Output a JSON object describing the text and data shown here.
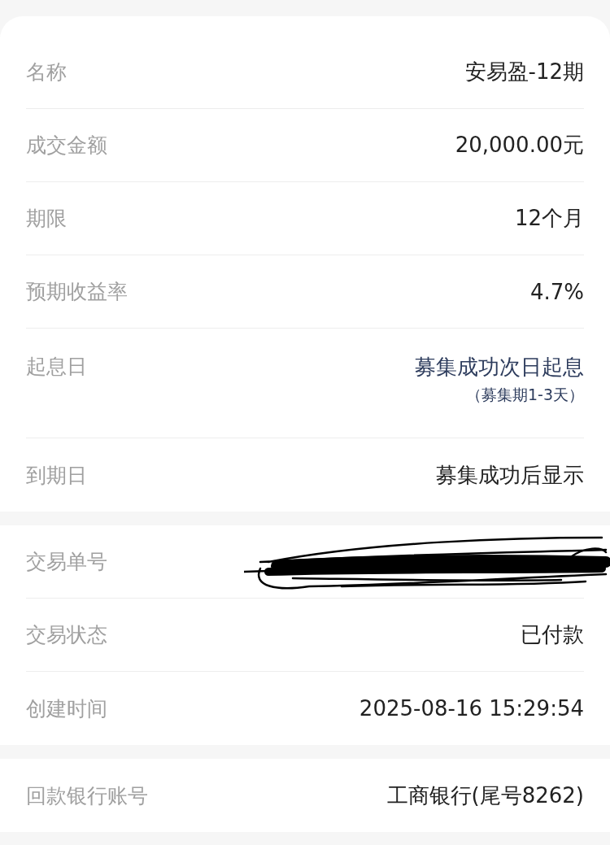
{
  "sections": [
    {
      "rows": [
        {
          "kind": "plain",
          "label": "名称",
          "value": "安易盈-12期"
        },
        {
          "kind": "plain",
          "label": "成交金额",
          "value": "20,000.00元"
        },
        {
          "kind": "plain",
          "label": "期限",
          "value": "12个月"
        },
        {
          "kind": "plain",
          "label": "预期收益率",
          "value": "4.7%"
        },
        {
          "kind": "accent",
          "label": "起息日",
          "value": "募集成功次日起息",
          "note": "（募集期1-3天）"
        },
        {
          "kind": "plain",
          "label": "到期日",
          "value": "募集成功后显示"
        }
      ]
    },
    {
      "rows": [
        {
          "kind": "redacted",
          "label": "交易单号"
        },
        {
          "kind": "plain",
          "label": "交易状态",
          "value": "已付款"
        },
        {
          "kind": "plain",
          "label": "创建时间",
          "value": "2025-08-16 15:29:54"
        }
      ]
    },
    {
      "rows": [
        {
          "kind": "plain",
          "label": "回款银行账号",
          "value": "工商银行(尾号8262)"
        }
      ]
    }
  ]
}
